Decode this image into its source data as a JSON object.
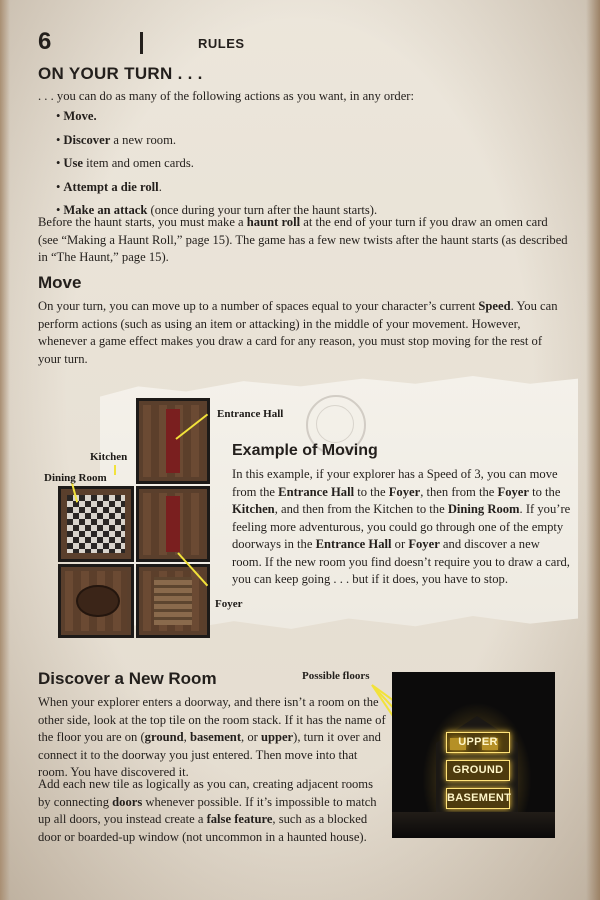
{
  "header": {
    "page_number": "6",
    "section": "RULES"
  },
  "turn": {
    "heading": "ON YOUR TURN . . .",
    "intro": ". . . you can do as many of the following actions as you want, in any order:",
    "actions": [
      {
        "bold": "Move.",
        "rest": ""
      },
      {
        "bold": "Discover",
        "rest": " a new room."
      },
      {
        "bold": "Use",
        "rest": " item and omen cards."
      },
      {
        "bold": "Attempt a die roll",
        "rest": "."
      },
      {
        "bold": "Make an attack",
        "rest": " (once during your turn after the haunt starts)."
      }
    ],
    "haunt_before": "Before the haunt starts, you must make a ",
    "haunt_bold": "haunt roll",
    "haunt_after": " at the end of your turn if you draw an omen card (see “Making a Haunt Roll,” page 15). The game has a few new twists after the haunt starts (as described in “The Haunt,” page 15)."
  },
  "move": {
    "heading": "Move",
    "p_a": "On your turn, you can move up to a number of spaces equal to your character’s current ",
    "p_bold": "Speed",
    "p_b": ". You can perform actions (such as using an item or attacking) in the middle of your movement. However, whenever a game effect makes you draw a card for any reason, you must stop moving for the rest of your turn."
  },
  "example": {
    "title": "Example of Moving",
    "t1": "In this example, if your explorer has a Speed of 3, you can move from the ",
    "b1": "Entrance Hall",
    "t2": " to the ",
    "b2": "Foyer",
    "t3": ", then from the ",
    "b3": "Foyer",
    "t4": " to the ",
    "b4": "Kitchen",
    "t5": ", and then from the Kitchen to the ",
    "b5": "Dining Room",
    "t6": ". If you’re feeling more adventurous, you could go through one of the empty doorways in the ",
    "b6": "Entrance Hall",
    "t7": " or ",
    "b7": "Foyer",
    "t8": " and discover a new room. If the new room you find doesn’t require you to draw a card, you can keep going . . . but if it does, you have to stop.",
    "labels": {
      "entrance": "Entrance Hall",
      "kitchen": "Kitchen",
      "dining": "Dining Room",
      "foyer": "Foyer"
    }
  },
  "discover": {
    "heading": "Discover a New Room",
    "p1_a": "When your explorer enters a doorway, and there isn’t a room on the other side, look at the top tile on the room stack. If it has the name of the floor you are on (",
    "p1_b1": "ground",
    "p1_c": ", ",
    "p1_b2": "basement",
    "p1_d": ", or ",
    "p1_b3": "upper",
    "p1_e": "), turn it over and connect it to the doorway you just entered. Then move into that room. You have discovered it.",
    "p2_a": "Add each new tile as logically as you can, creating adjacent rooms by connecting ",
    "p2_b1": "doors",
    "p2_c": " whenever possible. If it’s impossible to match up all doors, you instead create a ",
    "p2_b2": "false feature",
    "p2_d": ", such as a blocked door or boarded-up window (not uncommon in a haunted house)."
  },
  "floors_figure": {
    "caption": "Possible floors",
    "floors": [
      "UPPER",
      "GROUND",
      "BASEMENT"
    ]
  },
  "colors": {
    "leader": "#f2e23a",
    "glow": "#ffd24a",
    "ink": "#231f1c"
  }
}
